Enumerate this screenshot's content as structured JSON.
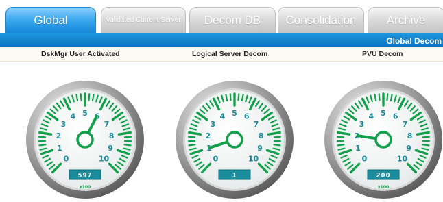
{
  "tabs": [
    {
      "label": "Global",
      "active": true
    },
    {
      "label": "Validated Current Server",
      "active": false
    },
    {
      "label": "Decom DB",
      "active": false
    },
    {
      "label": "Consolidation",
      "active": false
    },
    {
      "label": "Archive",
      "active": false
    }
  ],
  "header": {
    "title": "Global Decom"
  },
  "columns": [
    "DskMgr User Activated",
    "Logical Server Decom",
    "PVU Decom"
  ],
  "gauges": [
    {
      "name": "DskMgr User Activated",
      "value": "597",
      "reading": 597,
      "unit": "x100"
    },
    {
      "name": "Logical Server Decom",
      "value": "1",
      "reading": 1,
      "unit": ""
    },
    {
      "name": "PVU Decom",
      "value": "200",
      "reading": 200,
      "unit": "x100"
    }
  ],
  "dial": {
    "min": 0,
    "max": 10,
    "labels": [
      "0",
      "1",
      "2",
      "3",
      "4",
      "5",
      "6",
      "7",
      "8",
      "9",
      "10"
    ]
  },
  "colors": {
    "accent": "#1a8fd8",
    "gauge_green": "#13a04a",
    "display_teal": "#1a8c9c"
  }
}
